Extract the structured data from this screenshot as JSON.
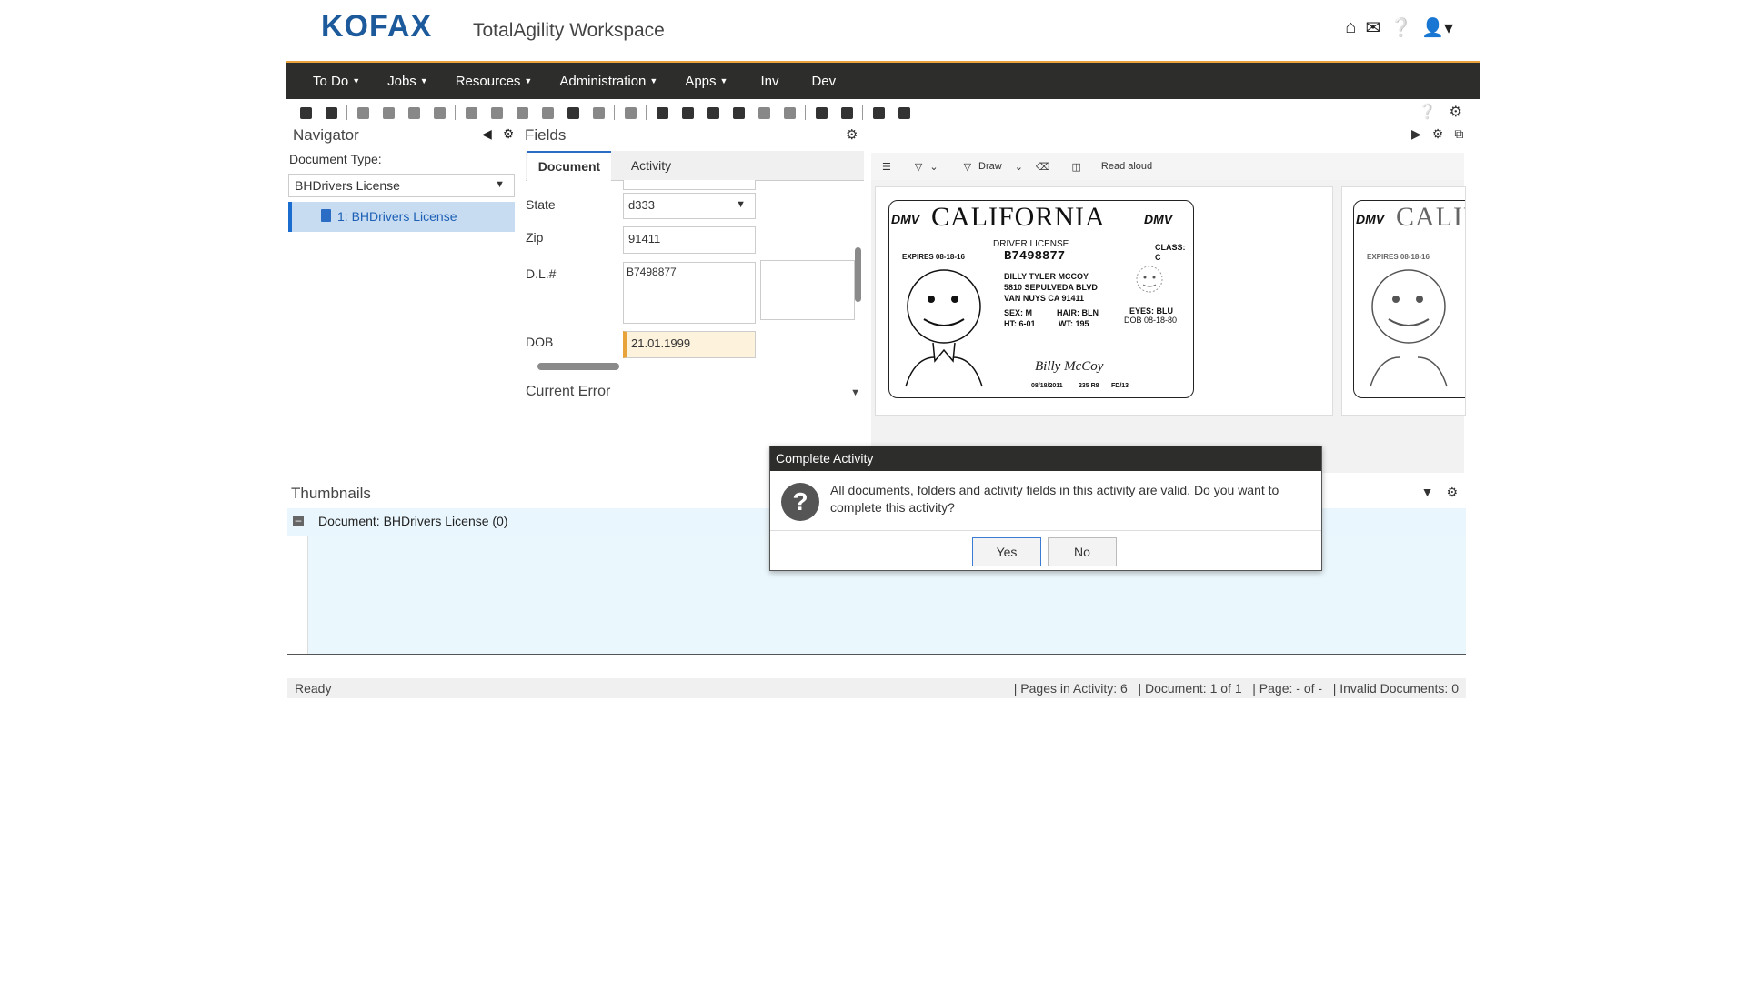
{
  "header": {
    "logo": "KOFAX",
    "app_title": "TotalAgility Workspace",
    "icons": [
      "home-icon",
      "mail-icon",
      "help-icon",
      "user-icon"
    ]
  },
  "menu": [
    {
      "label": "To Do",
      "caret": true
    },
    {
      "label": "Jobs",
      "caret": true
    },
    {
      "label": "Resources",
      "caret": true
    },
    {
      "label": "Administration",
      "caret": true
    },
    {
      "label": "Apps",
      "caret": true
    },
    {
      "label": "Inv",
      "caret": false
    },
    {
      "label": "Dev",
      "caret": false
    }
  ],
  "navigator": {
    "title": "Navigator",
    "doc_type_label": "Document Type:",
    "doc_type_value": "BHDrivers License",
    "tree_item": "1: BHDrivers License"
  },
  "fields": {
    "title": "Fields",
    "tabs": [
      "Document",
      "Activity"
    ],
    "state_label": "State",
    "state_value": "d333",
    "zip_label": "Zip",
    "zip_value": "91411",
    "dl_label": "D.L.#",
    "dl_value": "B7498877",
    "dob_label": "DOB",
    "dob_value": "21.01.1999",
    "current_error": "Current Error"
  },
  "viewer": {
    "draw_label": "Draw",
    "read_aloud_label": "Read aloud",
    "card": {
      "dmv": "DMV",
      "state": "CALIFORNIA",
      "driver_license": "DRIVER LICENSE",
      "expires": "EXPIRES 08-18-16",
      "dl_number": "B7498877",
      "class": "CLASS: C",
      "name": "BILLY TYLER MCCOY",
      "address1": "5810 SEPULVEDA BLVD",
      "address2": "VAN NUYS CA 91411",
      "sex": "SEX: M",
      "hair": "HAIR: BLN",
      "eyes": "EYES: BLU",
      "ht": "HT: 6-01",
      "wt": "WT: 195",
      "dob": "DOB 08-18-80",
      "signature": "Billy McCoy",
      "footer1": "08/18/2011",
      "footer2": "235 R8",
      "footer3": "FD/13"
    }
  },
  "thumbnails": {
    "title": "Thumbnails",
    "row_label": "Document: BHDrivers License (0)"
  },
  "status": {
    "ready": "Ready",
    "pages": "|  Pages in Activity: 6",
    "document": "|  Document: 1 of 1",
    "page": "|  Page: - of -",
    "invalid": "|  Invalid Documents: 0"
  },
  "dialog": {
    "title": "Complete Activity",
    "message": "All documents, folders and activity fields in this activity are valid. Do you want to complete this activity?",
    "yes": "Yes",
    "no": "No"
  },
  "colors": {
    "brand": "#1c5a9c",
    "menubar": "#2d2e2c",
    "accent_line": "#e8a33b",
    "selection": "#c7dcf1"
  }
}
